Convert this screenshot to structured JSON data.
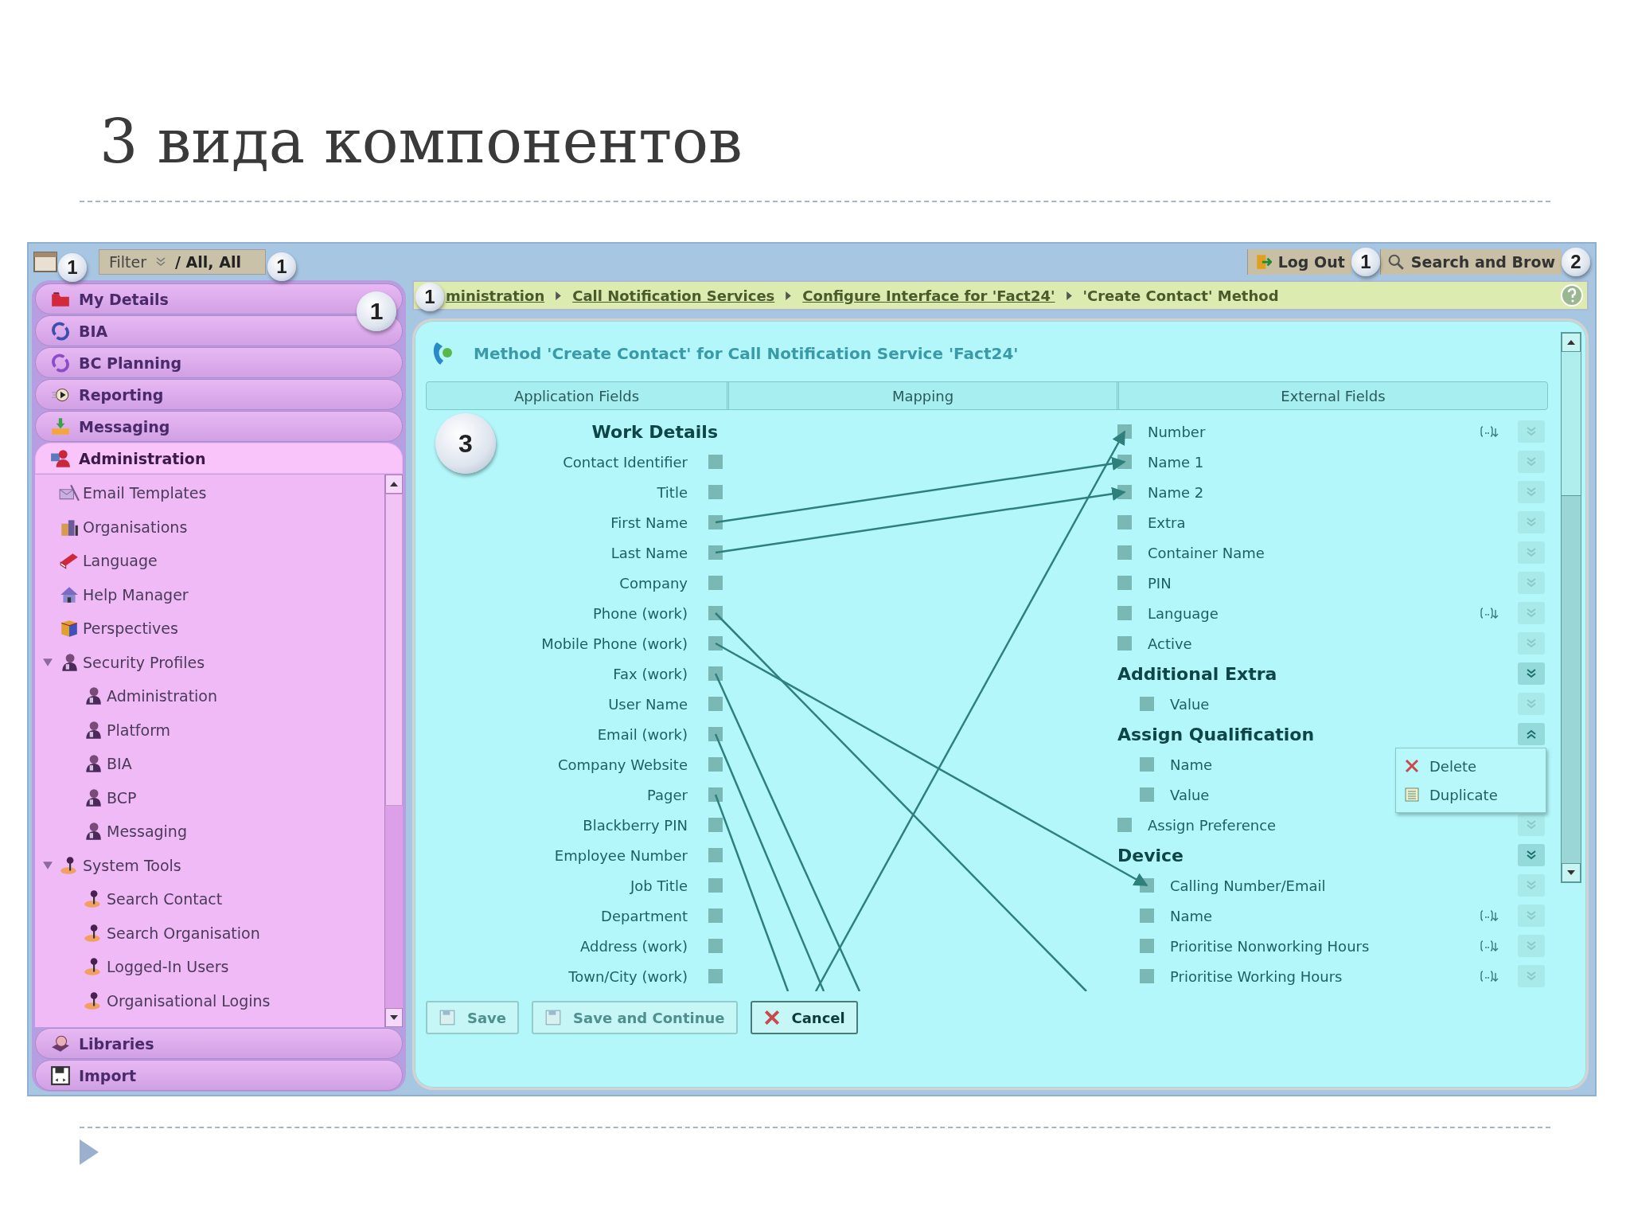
{
  "slide": {
    "title": "3 вида компонентов"
  },
  "top_bar": {
    "home_badge": "1",
    "filter": {
      "label": "Filter",
      "value": "/ All, All",
      "badge": "1"
    },
    "actions": [
      {
        "label": "Log Out",
        "kind": "logout",
        "badge": "1"
      },
      {
        "label": "Search and Brow",
        "kind": "search",
        "badge": "2"
      }
    ]
  },
  "sidebar": {
    "badge": "1",
    "sections": [
      {
        "label": "My Details",
        "kind": "folder",
        "expanded": false
      },
      {
        "label": "BIA",
        "kind": "swirl",
        "expanded": false
      },
      {
        "label": "BC Planning",
        "kind": "spiral",
        "expanded": false
      },
      {
        "label": "Reporting",
        "kind": "report",
        "expanded": false
      },
      {
        "label": "Messaging",
        "kind": "download",
        "expanded": false
      },
      {
        "label": "Administration",
        "kind": "admin",
        "expanded": true,
        "tree": [
          {
            "label": "Email Templates",
            "kind": "envelope"
          },
          {
            "label": "Organisations",
            "kind": "building"
          },
          {
            "label": "Language",
            "kind": "book"
          },
          {
            "label": "Help Manager",
            "kind": "house"
          },
          {
            "label": "Perspectives",
            "kind": "cube"
          },
          {
            "label": "Security Profiles",
            "kind": "profile",
            "expanded": true,
            "children": [
              {
                "label": "Administration",
                "kind": "profile"
              },
              {
                "label": "Platform",
                "kind": "profile"
              },
              {
                "label": "BIA",
                "kind": "profile"
              },
              {
                "label": "BCP",
                "kind": "profile"
              },
              {
                "label": "Messaging",
                "kind": "profile"
              }
            ]
          },
          {
            "label": "System Tools",
            "kind": "tool",
            "expanded": true,
            "children": [
              {
                "label": "Search Contact",
                "kind": "tool"
              },
              {
                "label": "Search Organisation",
                "kind": "tool"
              },
              {
                "label": "Logged-In Users",
                "kind": "tool"
              },
              {
                "label": "Organisational Logins",
                "kind": "tool"
              }
            ]
          }
        ]
      },
      {
        "label": "Libraries",
        "kind": "disc",
        "expanded": false
      },
      {
        "label": "Import",
        "kind": "floppy",
        "expanded": false
      }
    ]
  },
  "breadcrumb": {
    "badge": "1",
    "items": [
      {
        "label": "ministration",
        "link": true
      },
      {
        "label": "Call Notification Services",
        "link": true
      },
      {
        "label": "Configure Interface for 'Fact24'",
        "link": true
      },
      {
        "label": "'Create Contact' Method",
        "link": false
      }
    ]
  },
  "panel": {
    "title": "Method 'Create Contact' for Call Notification Service 'Fact24'",
    "badge": "3",
    "columns": [
      "Application Fields",
      "Mapping",
      "External Fields"
    ],
    "application_fields": {
      "heading": "Work Details",
      "fields": [
        "Contact Identifier",
        "Title",
        "First Name",
        "Last Name",
        "Company",
        "Phone (work)",
        "Mobile Phone (work)",
        "Fax (work)",
        "User Name",
        "Email (work)",
        "Company Website",
        "Pager",
        "Blackberry PIN",
        "Employee Number",
        "Job Title",
        "Department",
        "Address (work)",
        "Town/City (work)"
      ]
    },
    "external_fields": [
      {
        "kind": "field",
        "label": "Number",
        "transform": true
      },
      {
        "kind": "field",
        "label": "Name 1",
        "transform": false
      },
      {
        "kind": "field",
        "label": "Name 2",
        "transform": false
      },
      {
        "kind": "field",
        "label": "Extra",
        "transform": false
      },
      {
        "kind": "field",
        "label": "Container Name",
        "transform": false
      },
      {
        "kind": "field",
        "label": "PIN",
        "transform": false
      },
      {
        "kind": "field",
        "label": "Language",
        "transform": true
      },
      {
        "kind": "field",
        "label": "Active",
        "transform": false
      },
      {
        "kind": "group",
        "label": "Additional Extra",
        "menu_open": false,
        "children": [
          {
            "label": "Value",
            "transform": false
          }
        ]
      },
      {
        "kind": "group",
        "label": "Assign Qualification",
        "menu_open": true,
        "menu": [
          {
            "label": "Delete",
            "kind": "delete"
          },
          {
            "label": "Duplicate",
            "kind": "duplicate"
          }
        ],
        "children": [
          {
            "label": "Name",
            "transform": false
          },
          {
            "label": "Value",
            "transform": false
          }
        ]
      },
      {
        "kind": "field",
        "label": "Assign Preference",
        "transform": false
      },
      {
        "kind": "group",
        "label": "Device",
        "menu_open": false,
        "children": [
          {
            "label": "Calling Number/Email",
            "transform": false
          },
          {
            "label": "Name",
            "transform": true
          },
          {
            "label": "Prioritise Nonworking Hours",
            "transform": true
          },
          {
            "label": "Prioritise Working Hours",
            "transform": true
          }
        ]
      }
    ],
    "buttons": [
      {
        "label": "Save",
        "kind": "save",
        "disabled": true
      },
      {
        "label": "Save and Continue",
        "kind": "save",
        "disabled": true
      },
      {
        "label": "Cancel",
        "kind": "cancel",
        "disabled": false
      }
    ]
  }
}
